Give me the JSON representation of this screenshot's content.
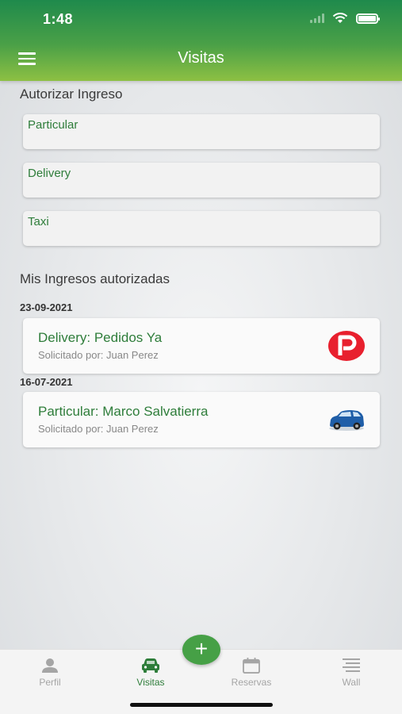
{
  "status_bar": {
    "time": "1:48"
  },
  "header": {
    "title": "Visitas"
  },
  "authorize": {
    "title": "Autorizar Ingreso",
    "options": [
      "Particular",
      "Delivery",
      "Taxi"
    ]
  },
  "my_entries": {
    "title": "Mis Ingresos autorizadas",
    "groups": [
      {
        "date": "23-09-2021",
        "title": "Delivery: Pedidos Ya",
        "subtitle": "Solicitado por: Juan Perez",
        "icon": "pedidos-ya-logo"
      },
      {
        "date": "16-07-2021",
        "title": "Particular: Marco Salvatierra",
        "subtitle": "Solicitado por: Juan Perez",
        "icon": "car-image"
      }
    ]
  },
  "fab": {
    "label": "+"
  },
  "tabs": [
    {
      "label": "Perfil",
      "icon": "person-icon",
      "active": false
    },
    {
      "label": "Visitas",
      "icon": "car-icon",
      "active": true
    },
    {
      "label": "Reservas",
      "icon": "calendar-icon",
      "active": false
    },
    {
      "label": "Wall",
      "icon": "wall-icon",
      "active": false
    }
  ],
  "colors": {
    "accent": "#2e7d3a",
    "header_start": "#1f8a4c",
    "header_end": "#8dc043",
    "fab": "#46a046"
  }
}
